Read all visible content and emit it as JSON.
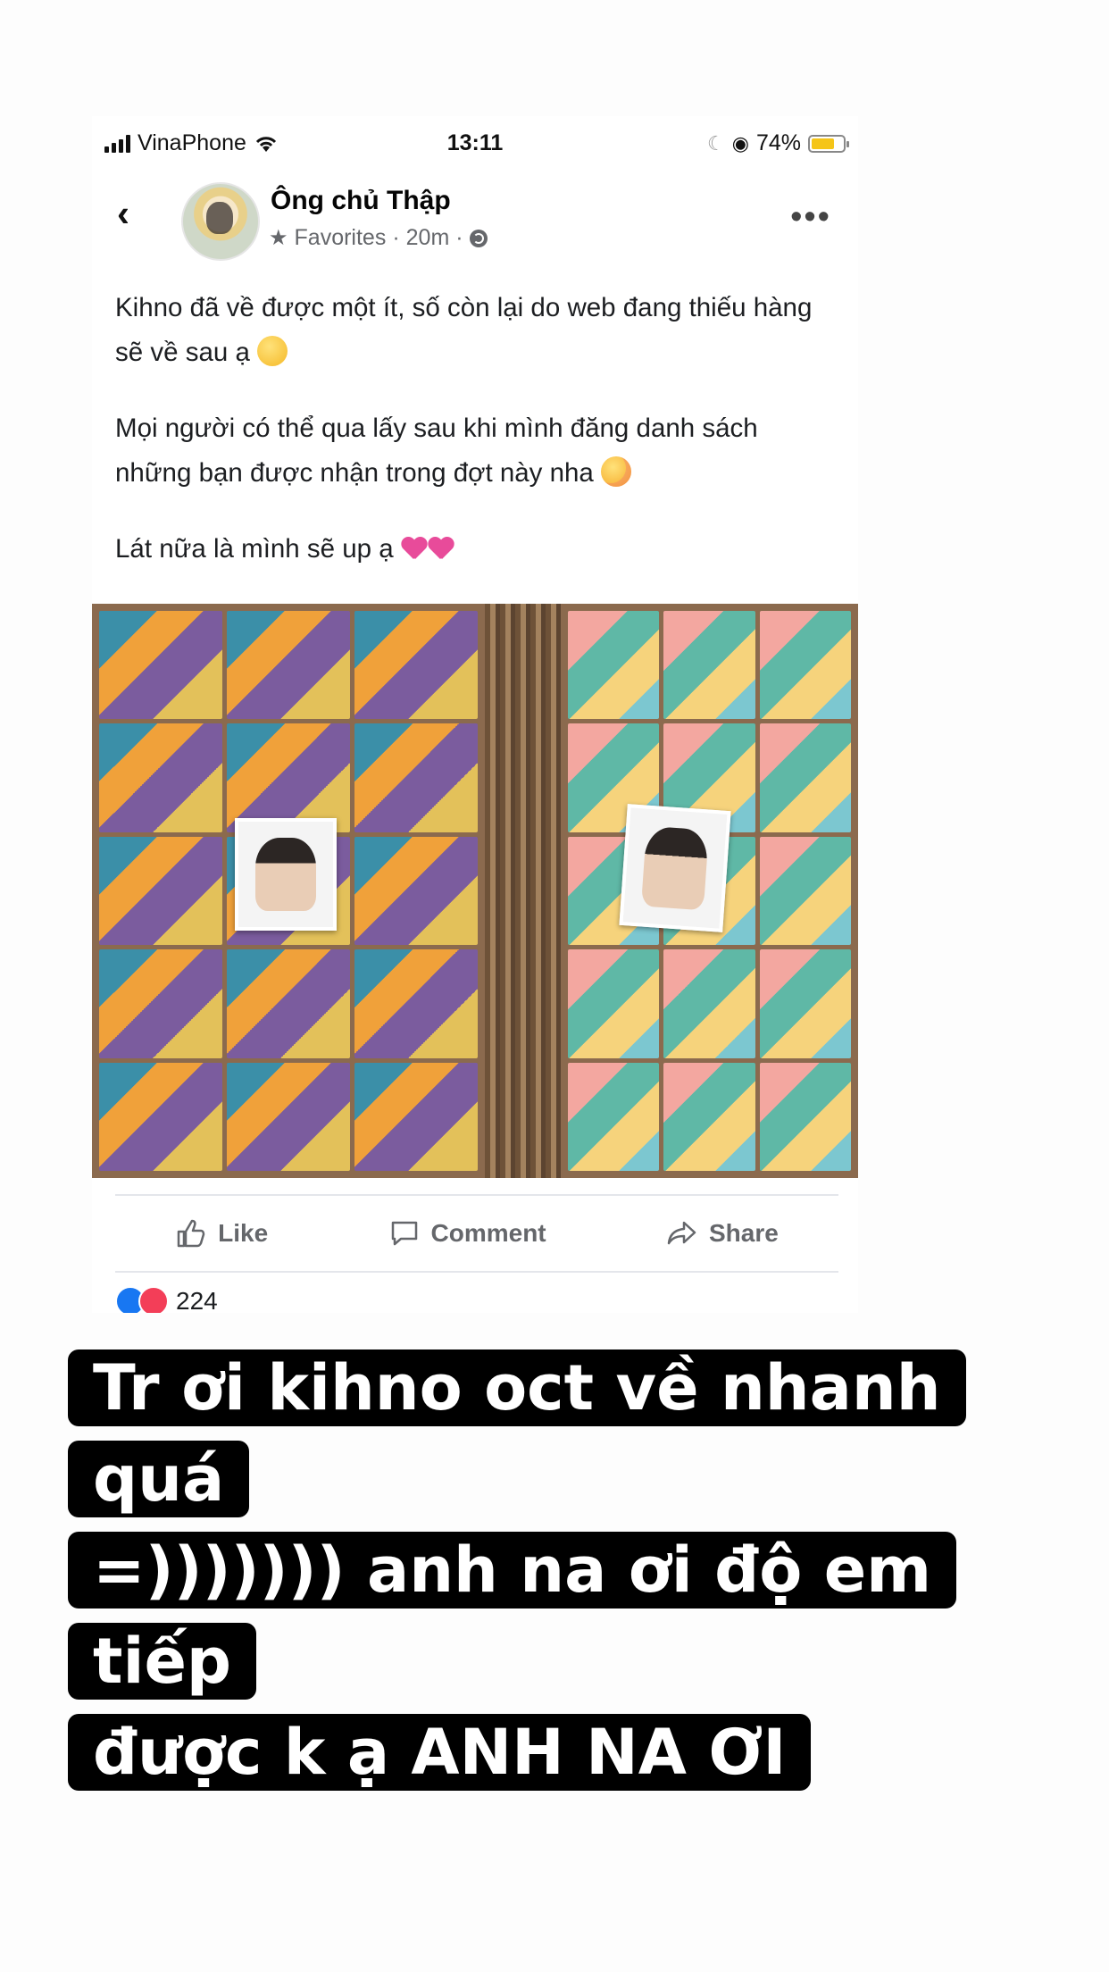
{
  "status_bar": {
    "carrier": "VinaPhone",
    "time": "13:11",
    "battery": "74%",
    "battery_level": 0.74
  },
  "post": {
    "author": "Ông chủ Thập",
    "audience": "Favorites",
    "time_ago": "20m",
    "paragraphs": [
      "Kihno đã về được một ít, số còn lại do web đang thiếu hàng sẽ về sau ạ",
      "Mọi người có thể qua lấy sau khi mình đăng danh sách những bạn được nhận trong đợt này nha",
      "Lát nữa là mình sẽ up ạ"
    ],
    "actions": {
      "like": "Like",
      "comment": "Comment",
      "share": "Share"
    },
    "reaction_count": "224"
  },
  "story_caption": {
    "line1": "Tr ơi kihno oct về nhanh quá",
    "line2": "=))))))) anh na ơi độ em tiếp",
    "line3": "được k ạ ANH NA ƠI"
  },
  "colors": {
    "accent": "#1877f2",
    "secondary_text": "#65676b",
    "caption_bg": "#000000"
  }
}
